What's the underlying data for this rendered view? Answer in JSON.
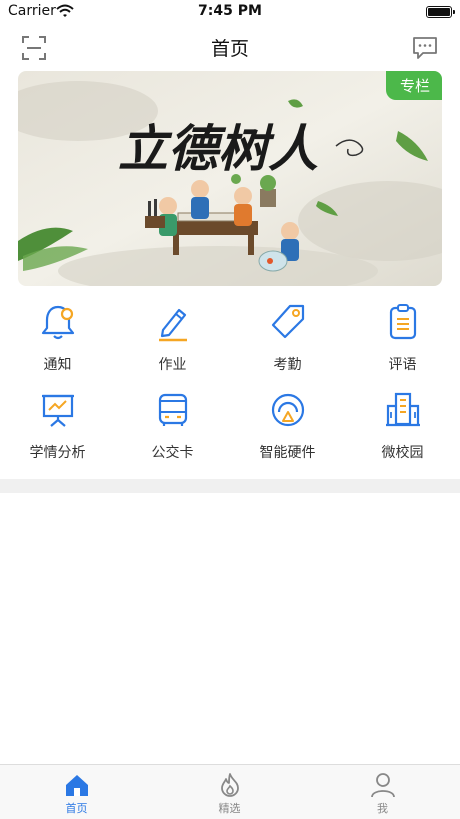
{
  "status_bar": {
    "carrier": "Carrier",
    "time": "7:45 PM"
  },
  "nav": {
    "title": "首页"
  },
  "banner": {
    "tag": "专栏",
    "calligraphy": "立德树人"
  },
  "features": [
    {
      "label": "通知",
      "icon": "bell-icon"
    },
    {
      "label": "作业",
      "icon": "pencil-icon"
    },
    {
      "label": "考勤",
      "icon": "tag-icon"
    },
    {
      "label": "评语",
      "icon": "clipboard-icon"
    },
    {
      "label": "学情分析",
      "icon": "chart-board-icon"
    },
    {
      "label": "公交卡",
      "icon": "bus-icon"
    },
    {
      "label": "智能硬件",
      "icon": "smart-device-icon"
    },
    {
      "label": "微校园",
      "icon": "building-icon"
    }
  ],
  "tabs": [
    {
      "label": "首页",
      "icon": "home-icon",
      "active": true
    },
    {
      "label": "精选",
      "icon": "flame-icon",
      "active": false
    },
    {
      "label": "我",
      "icon": "user-icon",
      "active": false
    }
  ],
  "colors": {
    "accent": "#2B78E4",
    "icon_orange": "#F5A623",
    "tag_green": "#4CB84A"
  }
}
